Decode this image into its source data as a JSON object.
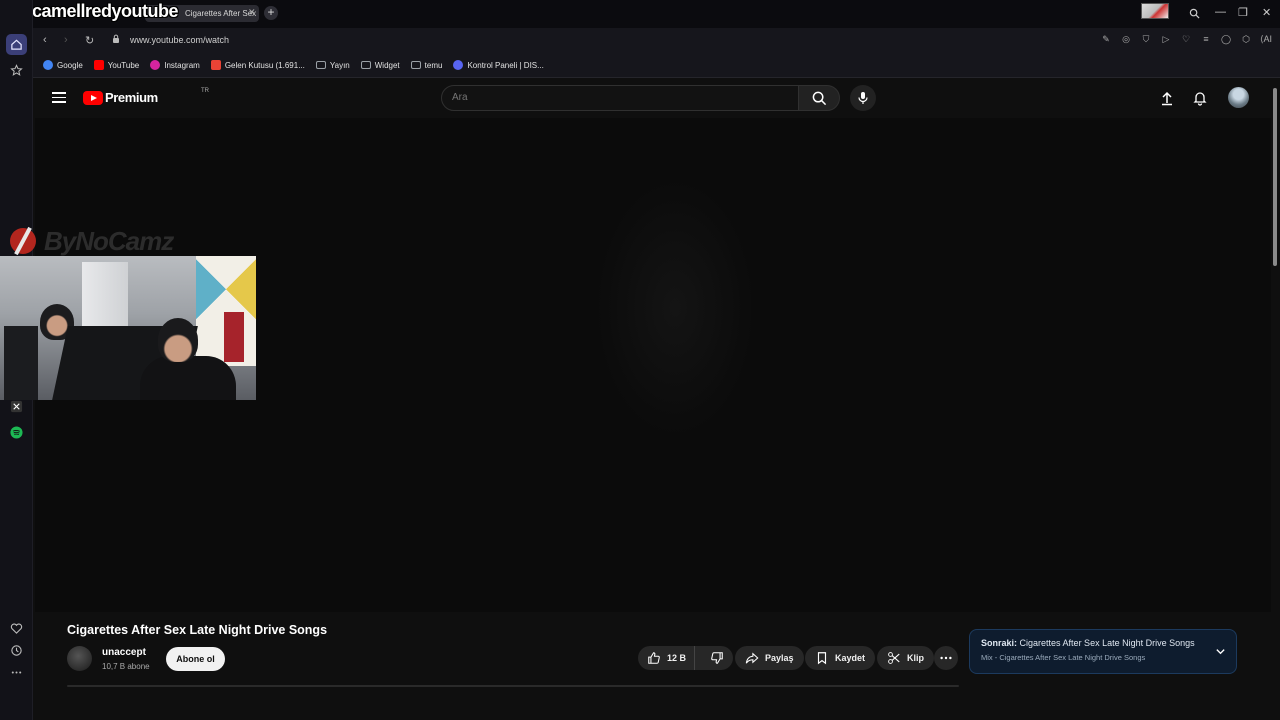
{
  "browser": {
    "overlay_channel_name": "camellredyoutube",
    "tab_title": "Cigarettes After Sex L",
    "url": "www.youtube.com/watch",
    "ai_label": "AI",
    "bookmarks": [
      {
        "label": "Google",
        "icon": "google-icon",
        "color": "#4285f4"
      },
      {
        "label": "YouTube",
        "icon": "youtube-icon",
        "color": "#ff0000"
      },
      {
        "label": "Instagram",
        "icon": "instagram-icon",
        "color": "#d6249f"
      },
      {
        "label": "Gelen Kutusu (1.691...",
        "icon": "gmail-icon",
        "color": "#ea4335"
      },
      {
        "label": "Yayın",
        "icon": "folder-icon",
        "color": "#9aa0a6"
      },
      {
        "label": "Widget",
        "icon": "folder-icon",
        "color": "#9aa0a6"
      },
      {
        "label": "temu",
        "icon": "folder-icon",
        "color": "#9aa0a6"
      },
      {
        "label": "Kontrol Paneli | DIS...",
        "icon": "discord-icon",
        "color": "#5865f2"
      }
    ]
  },
  "youtube": {
    "logo_text": "Premium",
    "region": "TR",
    "search_placeholder": "Ara",
    "video": {
      "title": "Cigarettes After Sex Late Night Drive Songs",
      "channel": "unaccept",
      "subscribers": "10,7 B abone",
      "subscribe_label": "Abone ol",
      "likes": "12 B",
      "share_label": "Paylaş",
      "save_label": "Kaydet",
      "clip_label": "Klip"
    },
    "up_next": {
      "prefix": "Sonraki:",
      "title": "Cigarettes After Sex Late Night Drive Songs",
      "subtitle": "Mix - Cigarettes After Sex Late Night Drive Songs"
    }
  },
  "overlay": {
    "stream_logo_text": "ByNoCamz"
  },
  "colors": {
    "accent": "#3b3f78",
    "youtube_red": "#ff0000",
    "background": "#0f0f0f"
  }
}
